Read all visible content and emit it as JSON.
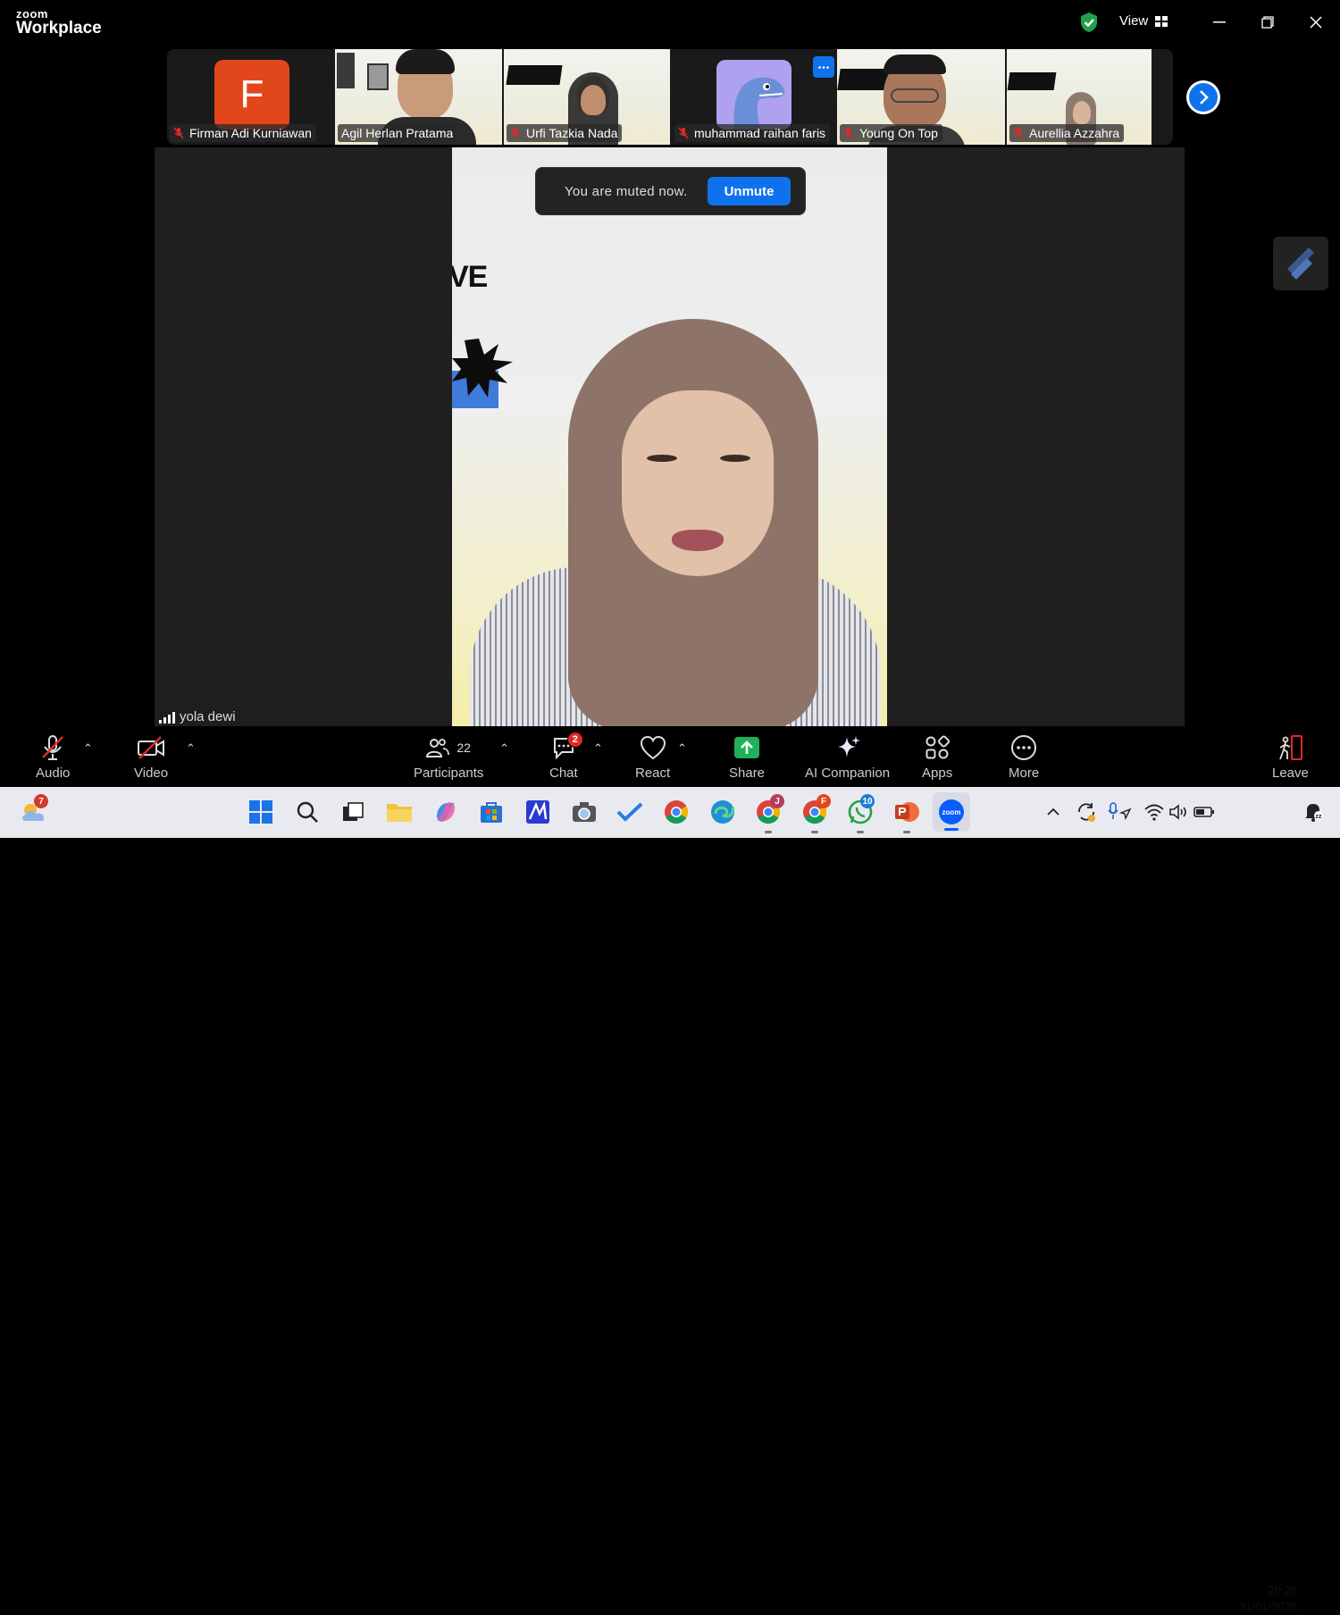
{
  "app": {
    "logo_top": "zoom",
    "logo_bottom": "Workplace",
    "view_label": "View"
  },
  "participants_strip": [
    {
      "name": "Firman Adi Kurniawan",
      "initial": "F",
      "avatar_color": "#e2471b"
    },
    {
      "name": "Agil Herlan Pratama"
    },
    {
      "name": "Urfi Tazkia Nada"
    },
    {
      "name": "muhammad raihan faris"
    },
    {
      "name": "Young On Top"
    },
    {
      "name": "Aurellia Azzahra"
    }
  ],
  "toast": {
    "message": "You are muted now.",
    "button": "Unmute"
  },
  "speaker_name": "yola dewi",
  "poster_text": "VE",
  "toolbar": {
    "audio": "Audio",
    "video": "Video",
    "participants": "Participants",
    "participants_count": "22",
    "chat": "Chat",
    "chat_badge": "2",
    "react": "React",
    "share": "Share",
    "ai": "AI Companion",
    "apps": "Apps",
    "more": "More",
    "leave": "Leave"
  },
  "taskbar": {
    "weather_badge": "7",
    "chrome_j": "J",
    "chrome_f": "F",
    "whatsapp_badge": "10",
    "time": "20:28",
    "date": "31/01/2025"
  },
  "colors": {
    "accent": "#0e72ed",
    "muted": "#e02828",
    "share_green": "#1db15a",
    "shield_green": "#1fa04b"
  }
}
